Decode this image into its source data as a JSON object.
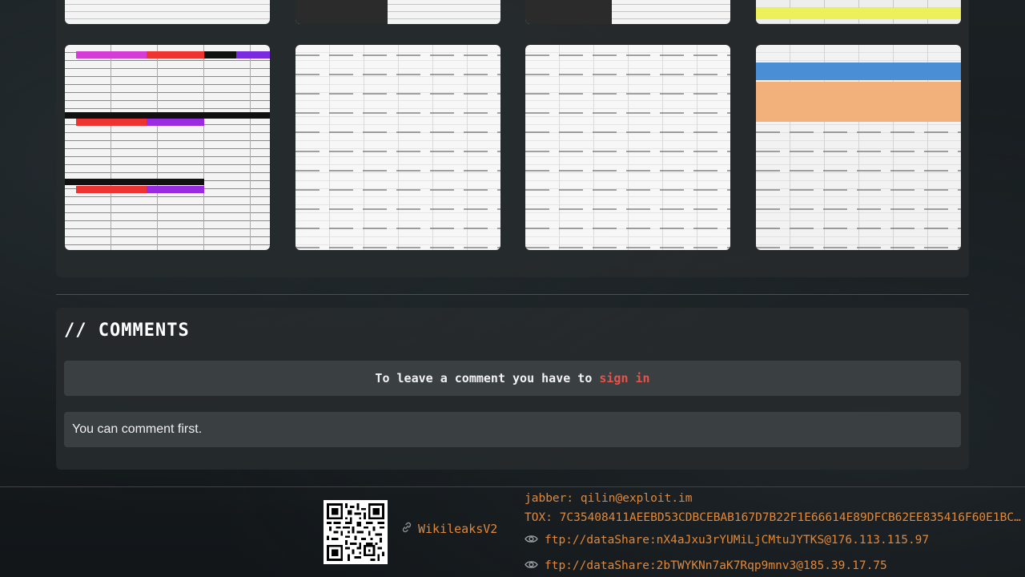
{
  "comments": {
    "title": "// COMMENTS",
    "signin_prompt": "To leave a comment you have to",
    "signin_link": "sign in",
    "empty_message": "You can comment first."
  },
  "footer": {
    "wikileaks_label": "WikileaksV2",
    "jabber": "jabber: qilin@exploit.im",
    "tox": "TOX: 7C35408411AEEBD53CDBCEBAB167D7B22F1E66614E89DFCB62EE835416F60E1BC…",
    "ftp_links": [
      "ftp://dataShare:nX4aJxu3rYUMiLjCMtuJYTKS@176.113.115.97",
      "ftp://dataShare:2bTWYKNn7aK7Rqp9mnv3@185.39.17.75"
    ]
  },
  "colors": {
    "accent": "#e0883a",
    "signin": "#e8524a"
  }
}
